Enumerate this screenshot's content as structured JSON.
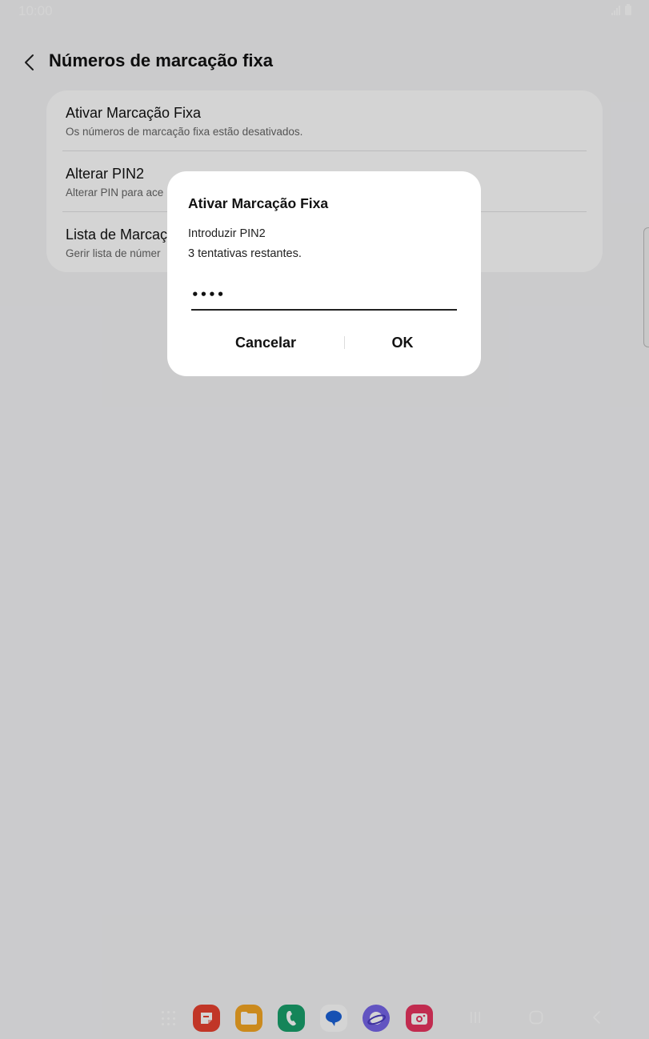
{
  "status_bar": {
    "time": "10:00"
  },
  "header": {
    "title": "Números de marcação fixa"
  },
  "settings": {
    "items": [
      {
        "title": "Ativar Marcação Fixa",
        "subtitle": "Os números de marcação fixa estão desativados."
      },
      {
        "title": "Alterar PIN2",
        "subtitle": "Alterar PIN para ace"
      },
      {
        "title": "Lista de Marcaç",
        "subtitle": "Gerir lista de númer"
      }
    ]
  },
  "dialog": {
    "title": "Ativar Marcação Fixa",
    "message_line1": "Introduzir PIN2",
    "message_line2": "3 tentativas restantes.",
    "pin_value": "••••",
    "cancel_label": "Cancelar",
    "ok_label": "OK"
  },
  "taskbar": {
    "apps": [
      {
        "name": "notes-app",
        "color": "#e8412f"
      },
      {
        "name": "files-app",
        "color": "#f5a623"
      },
      {
        "name": "phone-app",
        "color": "#19a06b"
      },
      {
        "name": "messages-app",
        "color": "#ffffff"
      },
      {
        "name": "internet-app",
        "color": "#7665e8"
      },
      {
        "name": "camera-app",
        "color": "#e8345f"
      }
    ]
  },
  "colors": {
    "background": "#f4f4f6",
    "card": "#ffffff",
    "scrim": "rgba(0,0,0,0.17)"
  }
}
